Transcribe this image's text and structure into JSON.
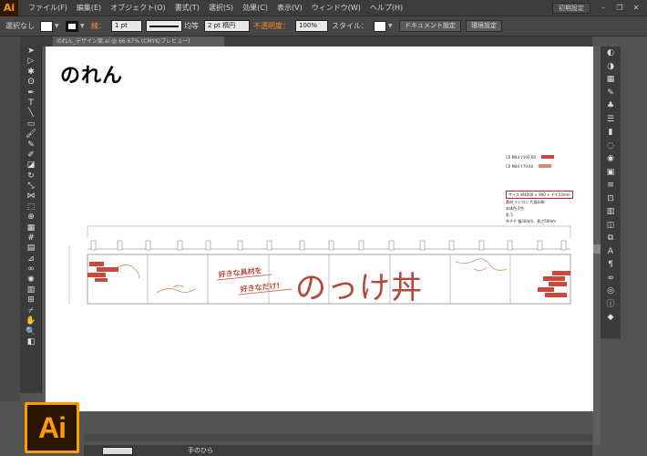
{
  "menubar": {
    "app_logo": "Ai",
    "items": [
      "ファイル(F)",
      "編集(E)",
      "オブジェクト(O)",
      "書式(T)",
      "選択(S)",
      "効果(C)",
      "表示(V)",
      "ウィンドウ(W)",
      "ヘルプ(H)"
    ],
    "workspace": "初期設定",
    "window_buttons": [
      "–",
      "❐",
      "✕"
    ]
  },
  "controlbar": {
    "selection_status": "選択なし",
    "stroke_label": "線：",
    "stroke_weight": "1 pt",
    "profile_label": "均等",
    "brush_label": "2 pt 楕円",
    "opacity_label": "不透明度：",
    "opacity_value": "100%",
    "style_label": "スタイル：",
    "doc_setup_button": "ドキュメント設定",
    "preferences_button": "環境設定"
  },
  "document": {
    "tab_label": "のれん_デザイン案.ai @ 66.67% (CMYK/プレビュー)"
  },
  "artboard": {
    "title": "のれん",
    "legend": [
      {
        "label": "C0 M84 Y100 K0",
        "color": "#c94a3a"
      },
      {
        "label": "C0 M84 Y70 K0",
        "color": "#d98a6e"
      }
    ],
    "spec_lines": [
      "サイズ W4000 × 900 + チチ53mm",
      "素材 テトロン 片面印刷",
      "本体色 1色",
      "乳 5",
      "共チチ 幅30mm、長さ50mm"
    ],
    "banner": {
      "sub_line1": "好きな具材を",
      "sub_line2": "好きなだけ!",
      "main_text": "のっけ丼"
    }
  },
  "status": {
    "tool_label": "手のひら"
  },
  "badge": {
    "label": "Ai"
  },
  "colors": {
    "accent": "#ff9a00",
    "brand_red": "#b5483a",
    "brand_light": "#d98a6e"
  }
}
